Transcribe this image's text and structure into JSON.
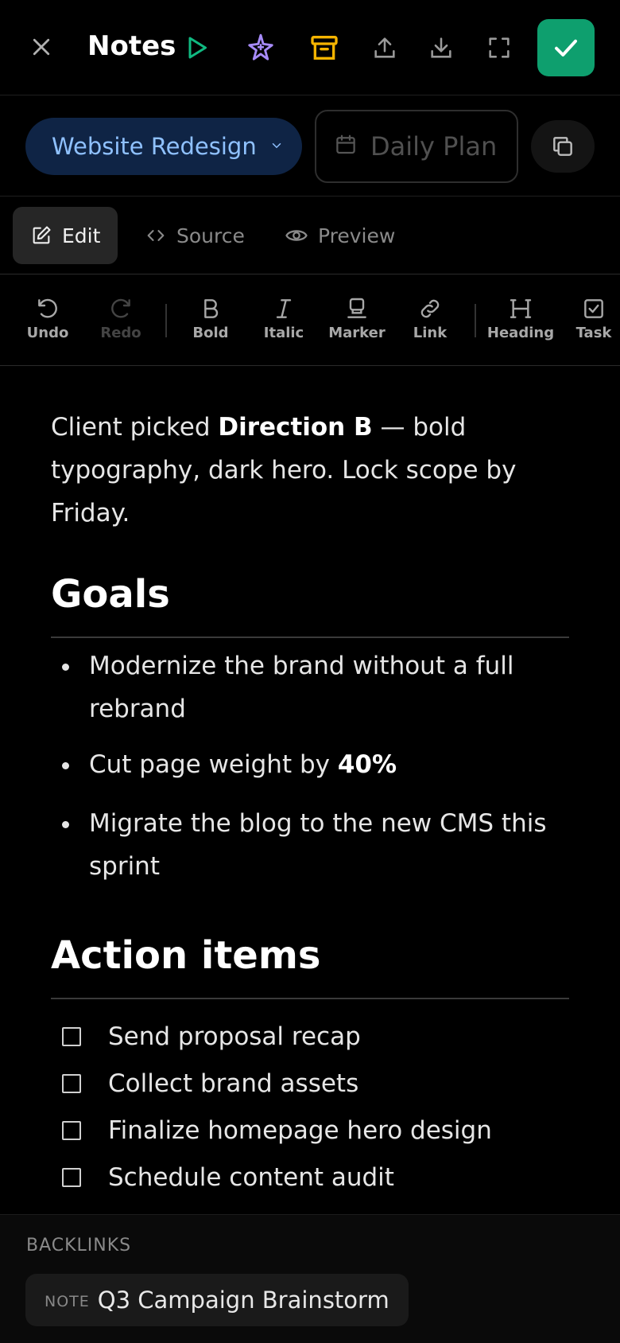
{
  "header": {
    "title": "Notes",
    "icons": [
      "close-icon",
      "play-icon",
      "sparkle-icon",
      "archive-icon",
      "upload-icon",
      "download-icon",
      "fullscreen-icon",
      "check-icon"
    ]
  },
  "project": {
    "name": "Website Redesign",
    "template": "Daily Plan"
  },
  "tabs": [
    {
      "label": "Edit",
      "active": true
    },
    {
      "label": "Source",
      "active": false
    },
    {
      "label": "Preview",
      "active": false
    }
  ],
  "toolbar": {
    "undo": "Undo",
    "redo": "Redo",
    "bold": "Bold",
    "italic": "Italic",
    "marker": "Marker",
    "link": "Link",
    "heading": "Heading",
    "task": "Task"
  },
  "note": {
    "intro_before": "Client picked ",
    "intro_bold": "Direction B",
    "intro_after": " — bold typography, dark hero. Lock scope by Friday.",
    "goals_heading": "Goals",
    "goals": {
      "g1": "Modernize the brand without a full rebrand",
      "g2_before": "Cut page weight by ",
      "g2_bold": "40%",
      "g3": "Migrate the blog to the new CMS this sprint"
    },
    "actions_heading": "Action items",
    "tasks": [
      "Send proposal recap",
      "Collect brand assets",
      "Finalize homepage hero design",
      "Schedule content audit"
    ]
  },
  "backlinks": {
    "heading": "BACKLINKS",
    "items": [
      {
        "kind": "NOTE",
        "title": "Q3 Campaign Brainstorm"
      }
    ]
  },
  "colors": {
    "accent_green": "#0e9f6e",
    "play_green": "#10b981",
    "sparkle_purple": "#a78bfa",
    "archive_amber": "#f5b400",
    "project_pill_bg": "#0f2445",
    "project_pill_text": "#8fc1ff"
  }
}
